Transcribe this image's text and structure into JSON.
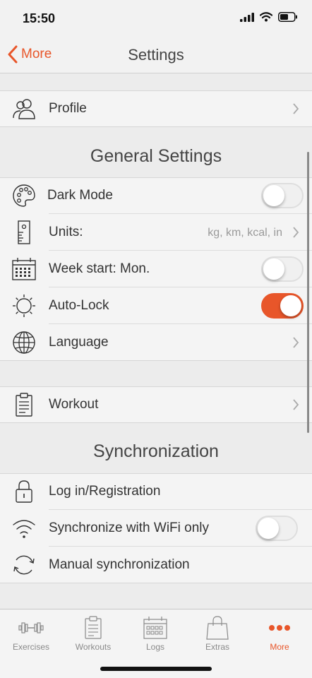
{
  "status": {
    "time": "15:50"
  },
  "nav": {
    "back_label": "More",
    "title": "Settings"
  },
  "profile": {
    "label": "Profile"
  },
  "general": {
    "header": "General Settings",
    "dark_mode": {
      "label": "Dark Mode",
      "on": false
    },
    "units": {
      "label": "Units:",
      "value": "kg, km, kcal, in"
    },
    "week_start": {
      "label": "Week start: Mon.",
      "on": false
    },
    "auto_lock": {
      "label": "Auto-Lock",
      "on": true
    },
    "language": {
      "label": "Language"
    }
  },
  "workout": {
    "label": "Workout"
  },
  "sync": {
    "header": "Synchronization",
    "login": {
      "label": "Log in/Registration"
    },
    "wifi_only": {
      "label": "Synchronize with WiFi only",
      "on": false
    },
    "manual": {
      "label": "Manual synchronization"
    }
  },
  "tabs": [
    {
      "label": "Exercises",
      "icon": "dumbbell-icon",
      "active": false
    },
    {
      "label": "Workouts",
      "icon": "clipboard-icon",
      "active": false
    },
    {
      "label": "Logs",
      "icon": "calendar-icon",
      "active": false
    },
    {
      "label": "Extras",
      "icon": "shopping-bag-icon",
      "active": false
    },
    {
      "label": "More",
      "icon": "more-dots-icon",
      "active": true
    }
  ],
  "colors": {
    "accent": "#e8562a",
    "background": "#ececec",
    "row": "#f4f4f4"
  }
}
